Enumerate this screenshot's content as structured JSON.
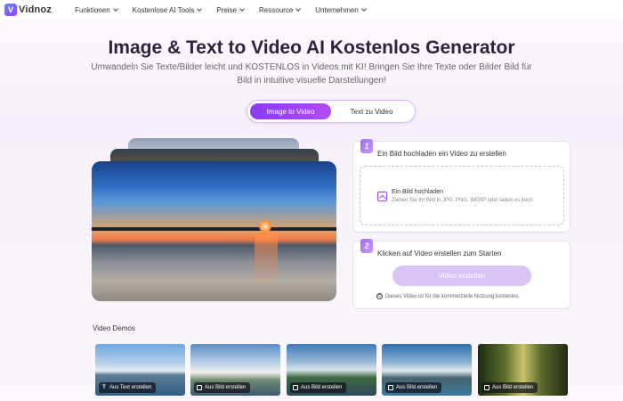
{
  "brand": {
    "logo_text": "Vidnoz"
  },
  "nav": {
    "items": [
      {
        "label": "Funktionen"
      },
      {
        "label": "Kostenlose AI Tools"
      },
      {
        "label": "Preise"
      },
      {
        "label": "Ressource"
      },
      {
        "label": "Unternehmen"
      }
    ]
  },
  "hero": {
    "title": "Image & Text to Video AI Kostenlos Generator",
    "subtitle": "Umwandeln Sie Texte/Bilder leicht und KOSTENLOS in Videos mit KI! Bringen Sie Ihre Texte oder Bilder Bild für Bild in intuitive visuelle Darstellungen!"
  },
  "toggle": {
    "active": "Image to Video",
    "inactive": "Text zu Video"
  },
  "step1": {
    "number": "1",
    "title": "Ein Bild hochladen ein Video zu erstellen",
    "upload_title": "Ein Bild hochladen",
    "upload_hint": "Ziehen Sie Ihr Bild in JPG, PNG, WEBP oder laden es hoch"
  },
  "step2": {
    "number": "2",
    "title": "Klicken auf Video erstellen zum Starten",
    "button": "Video erstellen",
    "notice": "Dieses Video ist für die kommerzielle Nutzung kostenlos."
  },
  "demos": {
    "title": "Video Demos",
    "items": [
      {
        "label": "Aus Text erstellen",
        "icon": "text-icon"
      },
      {
        "label": "Aus Bild erstellen",
        "icon": "image-icon"
      },
      {
        "label": "Aus Bild erstellen",
        "icon": "image-icon"
      },
      {
        "label": "Aus Bild erstellen",
        "icon": "image-icon"
      },
      {
        "label": "Aus Bild erstellen",
        "icon": "image-icon"
      }
    ]
  },
  "colors": {
    "accent": "#9a45e8",
    "button_disabled": "#d9c4f6",
    "title": "#2b2440"
  }
}
